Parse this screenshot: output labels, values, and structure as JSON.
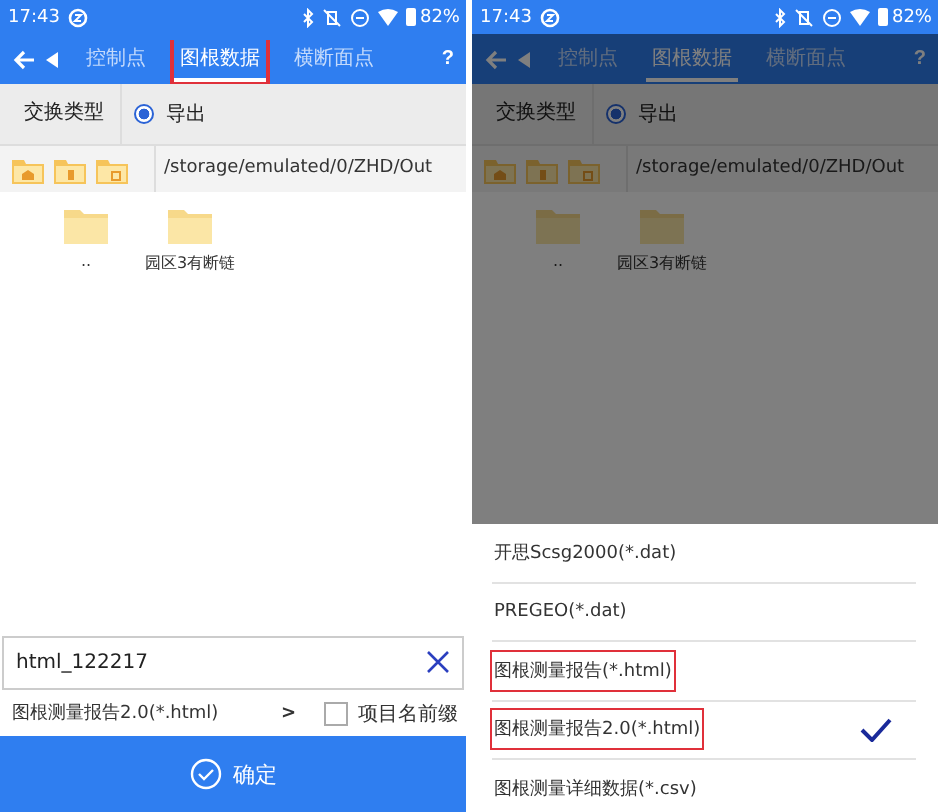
{
  "screens": [
    {
      "dimmed": false,
      "status_bar": {
        "time": "17:43",
        "battery": "82%"
      },
      "app_bar": {
        "tabs": [
          {
            "label": "控制点",
            "selected": false,
            "highlighted": false
          },
          {
            "label": "图根数据",
            "selected": true,
            "highlighted": true
          },
          {
            "label": "横断面点",
            "selected": false,
            "highlighted": false
          }
        ],
        "help": "?"
      },
      "exchange": {
        "label": "交换类型",
        "option": "导出",
        "selected": true
      },
      "path": "/storage/emulated/0/ZHD/Out",
      "folders": [
        {
          "name": ".."
        },
        {
          "name": "园区3有断链"
        }
      ],
      "filename": {
        "value": "html_122217"
      },
      "format": {
        "value": "图根测量报告2.0(*.html)",
        "arrow": ">",
        "prefix_label": "项目名前缀",
        "prefix_checked": false
      },
      "confirm": "确定"
    },
    {
      "dimmed": true,
      "status_bar": {
        "time": "17:43",
        "battery": "82%"
      },
      "app_bar": {
        "tabs": [
          {
            "label": "控制点",
            "selected": false,
            "highlighted": false
          },
          {
            "label": "图根数据",
            "selected": true,
            "highlighted": false
          },
          {
            "label": "横断面点",
            "selected": false,
            "highlighted": false
          }
        ],
        "help": "?"
      },
      "exchange": {
        "label": "交换类型",
        "option": "导出",
        "selected": true
      },
      "path": "/storage/emulated/0/ZHD/Out",
      "folders": [
        {
          "name": ".."
        },
        {
          "name": "园区3有断链"
        }
      ],
      "sheet": {
        "items": [
          {
            "label": "开思Scsg2000(*.dat)",
            "selected": false,
            "highlighted": false
          },
          {
            "label": "PREGEO(*.dat)",
            "selected": false,
            "highlighted": false
          },
          {
            "label": "图根测量报告(*.html)",
            "selected": false,
            "highlighted": true
          },
          {
            "label": "图根测量报告2.0(*.html)",
            "selected": true,
            "highlighted": true
          },
          {
            "label": "图根测量详细数据(*.csv)",
            "selected": false,
            "highlighted": false
          }
        ]
      }
    }
  ]
}
